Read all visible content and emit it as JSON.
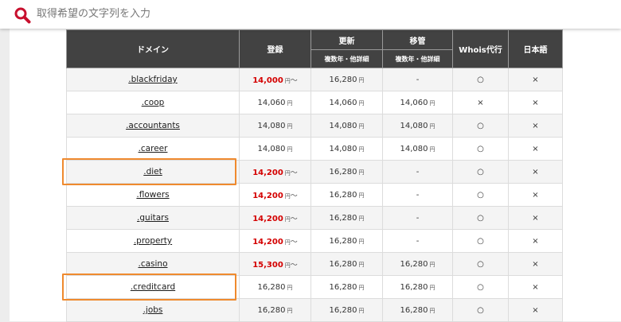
{
  "search": {
    "placeholder": "取得希望の文字列を入力",
    "value": ""
  },
  "colors": {
    "header_bg": "#424242",
    "accent_red": "#d40000",
    "highlight_orange": "#ef8a2e",
    "search_icon": "#c8102e"
  },
  "icons": {
    "search": "search-icon"
  },
  "table": {
    "headers": {
      "domain": "ドメイン",
      "register": "登録",
      "renew": "更新",
      "transfer": "移管",
      "whois": "Whois代行",
      "japanese": "日本語",
      "renew_sub": "複数年・他詳細",
      "transfer_sub": "複数年・他詳細"
    },
    "yen": "円",
    "tilde": "〜",
    "rows": [
      {
        "domain": ".blackfriday",
        "register": "14,000",
        "register_red": true,
        "register_tilde": true,
        "renew": "16,280",
        "renew_yen": true,
        "transfer": "-",
        "transfer_yen": false,
        "whois": "○",
        "japanese": "×",
        "highlighted": false
      },
      {
        "domain": ".coop",
        "register": "14,060",
        "register_red": false,
        "register_tilde": false,
        "renew": "14,060",
        "renew_yen": true,
        "transfer": "14,060",
        "transfer_yen": true,
        "whois": "×",
        "japanese": "×",
        "highlighted": false
      },
      {
        "domain": ".accountants",
        "register": "14,080",
        "register_red": false,
        "register_tilde": false,
        "renew": "14,080",
        "renew_yen": true,
        "transfer": "14,080",
        "transfer_yen": true,
        "whois": "○",
        "japanese": "×",
        "highlighted": false
      },
      {
        "domain": ".career",
        "register": "14,080",
        "register_red": false,
        "register_tilde": false,
        "renew": "14,080",
        "renew_yen": true,
        "transfer": "14,080",
        "transfer_yen": true,
        "whois": "○",
        "japanese": "×",
        "highlighted": false
      },
      {
        "domain": ".diet",
        "register": "14,200",
        "register_red": true,
        "register_tilde": true,
        "renew": "16,280",
        "renew_yen": true,
        "transfer": "-",
        "transfer_yen": false,
        "whois": "○",
        "japanese": "×",
        "highlighted": true
      },
      {
        "domain": ".flowers",
        "register": "14,200",
        "register_red": true,
        "register_tilde": true,
        "renew": "16,280",
        "renew_yen": true,
        "transfer": "-",
        "transfer_yen": false,
        "whois": "○",
        "japanese": "×",
        "highlighted": false
      },
      {
        "domain": ".guitars",
        "register": "14,200",
        "register_red": true,
        "register_tilde": true,
        "renew": "16,280",
        "renew_yen": true,
        "transfer": "-",
        "transfer_yen": false,
        "whois": "○",
        "japanese": "×",
        "highlighted": false
      },
      {
        "domain": ".property",
        "register": "14,200",
        "register_red": true,
        "register_tilde": true,
        "renew": "16,280",
        "renew_yen": true,
        "transfer": "-",
        "transfer_yen": false,
        "whois": "○",
        "japanese": "×",
        "highlighted": false
      },
      {
        "domain": ".casino",
        "register": "15,300",
        "register_red": true,
        "register_tilde": true,
        "renew": "16,280",
        "renew_yen": true,
        "transfer": "16,280",
        "transfer_yen": true,
        "whois": "○",
        "japanese": "×",
        "highlighted": false
      },
      {
        "domain": ".creditcard",
        "register": "16,280",
        "register_red": false,
        "register_tilde": false,
        "renew": "16,280",
        "renew_yen": true,
        "transfer": "16,280",
        "transfer_yen": true,
        "whois": "○",
        "japanese": "×",
        "highlighted": true
      },
      {
        "domain": ".jobs",
        "register": "16,280",
        "register_red": false,
        "register_tilde": false,
        "renew": "16,280",
        "renew_yen": true,
        "transfer": "16,280",
        "transfer_yen": true,
        "whois": "○",
        "japanese": "×",
        "highlighted": false
      }
    ]
  }
}
